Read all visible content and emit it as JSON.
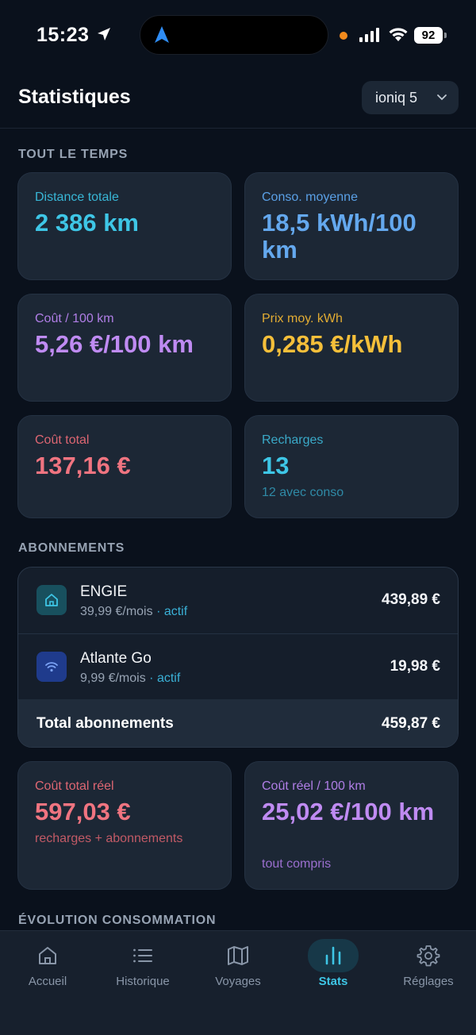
{
  "status_bar": {
    "time": "15:23",
    "battery": "92"
  },
  "header": {
    "title": "Statistiques",
    "vehicle": "ioniq 5"
  },
  "all_time": {
    "section_label": "TOUT LE TEMPS",
    "distance": {
      "label": "Distance totale",
      "value": "2 386 km"
    },
    "consumption": {
      "label": "Conso. moyenne",
      "value": "18,5 kWh/100 km"
    },
    "cost_per_100": {
      "label": "Coût / 100 km",
      "value": "5,26 €/100 km"
    },
    "avg_price": {
      "label": "Prix moy. kWh",
      "value": "0,285 €/kWh"
    },
    "total_cost": {
      "label": "Coût total",
      "value": "137,16 €"
    },
    "charges": {
      "label": "Recharges",
      "value": "13",
      "sub": "12 avec conso"
    }
  },
  "subscriptions": {
    "section_label": "ABONNEMENTS",
    "items": [
      {
        "name": "ENGIE",
        "price": "39,99 €/mois",
        "status": "· actif",
        "total": "439,89 €",
        "icon": "home-icon",
        "icon_color": "#3ab0c8"
      },
      {
        "name": "Atlante Go",
        "price": "9,99 €/mois",
        "status": "· actif",
        "total": "19,98 €",
        "icon": "wifi-icon",
        "icon_color": "#6a8ef0"
      }
    ],
    "total_label": "Total abonnements",
    "total_value": "459,87 €"
  },
  "real_costs": {
    "total": {
      "label": "Coût total réel",
      "value": "597,03 €",
      "sub": "recharges + abonnements"
    },
    "per_100": {
      "label": "Coût réel / 100 km",
      "value": "25,02 €/100 km",
      "sub": "tout compris"
    }
  },
  "evolution": {
    "section_label": "ÉVOLUTION CONSOMMATION"
  },
  "tabbar": {
    "tabs": [
      {
        "label": "Accueil",
        "icon": "home-icon"
      },
      {
        "label": "Historique",
        "icon": "list-icon"
      },
      {
        "label": "Voyages",
        "icon": "map-icon"
      },
      {
        "label": "Stats",
        "icon": "bar-chart-icon",
        "active": true
      },
      {
        "label": "Réglages",
        "icon": "gear-icon"
      }
    ]
  },
  "colors": {
    "background": "#0a111c",
    "card": "#1c2735",
    "accent": "#3ec6e6",
    "purple": "#bf8bf2",
    "yellow": "#f5bf3a",
    "red": "#f07480",
    "blue": "#64a8ee"
  }
}
